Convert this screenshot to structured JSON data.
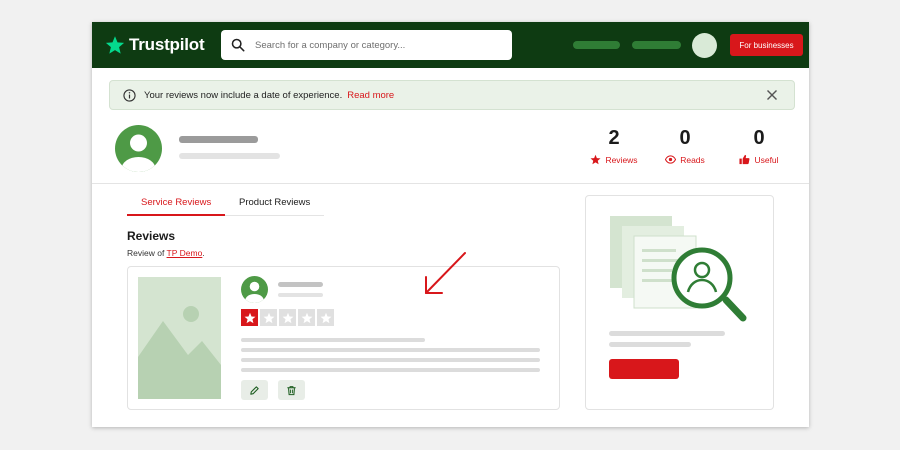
{
  "header": {
    "logo_text": "Trustpilot",
    "logo_icon": "star-icon",
    "search_placeholder": "Search for a company or category...",
    "for_businesses_label": "For businesses"
  },
  "notice": {
    "text": "Your reviews now include a date of experience.",
    "link_label": "Read more"
  },
  "profile": {
    "stats": [
      {
        "value": "2",
        "label": "Reviews",
        "icon": "star-icon"
      },
      {
        "value": "0",
        "label": "Reads",
        "icon": "eye-icon"
      },
      {
        "value": "0",
        "label": "Useful",
        "icon": "thumbs-up-icon"
      }
    ]
  },
  "tabs": [
    {
      "label": "Service Reviews",
      "active": true
    },
    {
      "label": "Product Reviews",
      "active": false
    }
  ],
  "reviews": {
    "title": "Reviews",
    "review_of_prefix": "Review of",
    "company_link": "TP Demo",
    "suffix": ".",
    "card": {
      "rating": 1,
      "max_rating": 5,
      "actions": [
        "pencil-icon",
        "trash-icon"
      ]
    }
  },
  "colors": {
    "header_bg": "#0e3b12",
    "brand_green": "#4e9a46",
    "accent_red": "#d8171b",
    "notice_bg": "#eaf2e8"
  }
}
